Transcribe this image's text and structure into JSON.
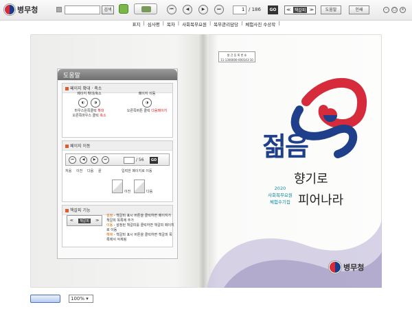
{
  "toolbar": {
    "logo_text": "병무청",
    "search_placeholder": "",
    "search_button": "검색",
    "page_current": "1",
    "page_total": "/ 186",
    "go_button": "GO",
    "view_prev": "≪",
    "view_mode": "책갈피",
    "view_next": "≫",
    "help_button": "도움말",
    "print_button": "인쇄"
  },
  "menu": {
    "items": [
      "표지",
      "심사평",
      "목차",
      "사회복무요원",
      "복무관리담당",
      "체험사진 수상작"
    ]
  },
  "help": {
    "title": "도움말",
    "zoom_section": {
      "title": "페이지 확대 · 축소",
      "left_label": "페이지 확대/축소",
      "left_line1": "마우스왼쪽클릭 ",
      "left_line1_red": "확대",
      "left_line2": "오른쪽마우스 클릭 ",
      "left_line2_red": "축소",
      "right_label": "페이지 이동",
      "right_line1": "오른쪽버튼 클릭 ",
      "right_line1_red": "다음페이지"
    },
    "move_section": {
      "title": "페이지 이동",
      "total": "/ 56",
      "go": "GO",
      "labels": [
        "처음",
        "이전",
        "다음",
        "끝",
        "입력한 페이지로 이동"
      ],
      "corner_prev": "이전",
      "corner_next": "다음"
    },
    "bookmark_section": {
      "title": "책갈피 기능",
      "box_label": "책갈피",
      "add_prefix": "설정",
      "add_text": " - 책갈피 표시 버튼을 클릭하면 페이지가 책갈피 목록에 추가",
      "move_prefix": "이동",
      "move_text": " - 설정된 책갈피를 클릭하면 책갈피 페이지로 이동",
      "del_prefix": "해제",
      "del_text": " - 책갈피 표시 버튼을 클릭하면 책갈피 목록에서 삭제됨"
    }
  },
  "cover": {
    "isbn_label": "발 간 등 록 번 호",
    "isbn_number": "11-1300000-000143-10",
    "year": "2020",
    "line1": "사회복무요원",
    "line2": "체험수기집",
    "title": "젊음",
    "sub1": "향기로",
    "sub2": "피어나라",
    "brand": "병무청"
  },
  "bottom": {
    "zoom_value": "100%"
  },
  "colors": {
    "accent_blue": "#1f3f8a",
    "accent_red": "#d52b3a",
    "teal": "#0a8a9a"
  }
}
